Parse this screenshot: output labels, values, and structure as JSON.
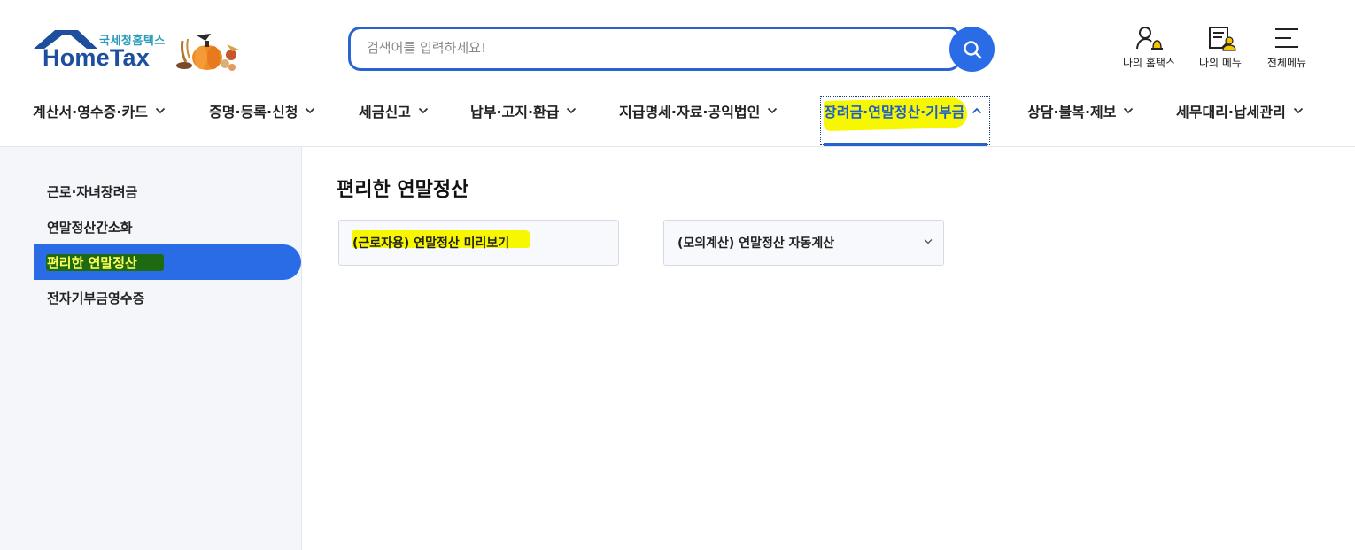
{
  "header": {
    "logo_org": "국세청홈택스",
    "logo_name": "HomeTax",
    "search_placeholder": "검색어를 입력하세요!",
    "utilities": [
      {
        "label": "나의 홈택스",
        "icon": "user-bell-icon"
      },
      {
        "label": "나의 메뉴",
        "icon": "my-menu-icon"
      },
      {
        "label": "전체메뉴",
        "icon": "hamburger-menu-icon"
      }
    ]
  },
  "gnb": {
    "items": [
      {
        "label": "계산서·영수증·카드"
      },
      {
        "label": "증명·등록·신청"
      },
      {
        "label": "세금신고"
      },
      {
        "label": "납부·고지·환급"
      },
      {
        "label": "지급명세·자료·공익법인"
      },
      {
        "label": "장려금·연말정산·기부금",
        "active": true
      },
      {
        "label": "상담·불복·제보"
      },
      {
        "label": "세무대리·납세관리"
      }
    ]
  },
  "sidebar": {
    "items": [
      {
        "label": "근로·자녀장려금"
      },
      {
        "label": "연말정산간소화"
      },
      {
        "label": "편리한 연말정산",
        "active": true
      },
      {
        "label": "전자기부금영수증"
      }
    ]
  },
  "main": {
    "title": "편리한 연말정산",
    "cards": [
      {
        "label": "(근로자용) 연말정산 미리보기"
      },
      {
        "label": "(모의계산) 연말정산 자동계산",
        "has_dropdown": true
      }
    ]
  },
  "colors": {
    "primary": "#2a6ce6",
    "logo_blue": "#1d4f9e",
    "logo_teal": "#2a9bb8",
    "highlight_yellow": "#f7f700",
    "highlight_green": "#1e6a12",
    "sidebar_bg": "#f4f6fa"
  }
}
